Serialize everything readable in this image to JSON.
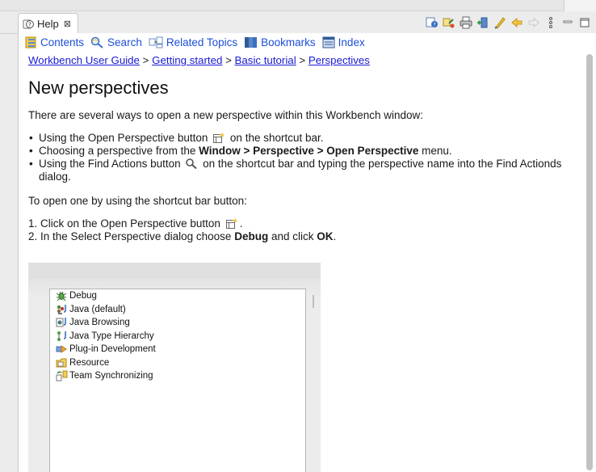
{
  "view_tab": {
    "title": "Help",
    "close_glyph": "⊠"
  },
  "toolbar": {
    "icons": [
      "show-in-toc-icon",
      "link-icon",
      "print-icon",
      "bookmark-add-icon",
      "highlight-icon",
      "back-icon",
      "forward-icon",
      "view-menu-icon",
      "minimize-icon",
      "maximize-icon"
    ]
  },
  "navbar": {
    "items": [
      {
        "label": "Contents",
        "icon": "contents-icon"
      },
      {
        "label": "Search",
        "icon": "search-icon"
      },
      {
        "label": "Related Topics",
        "icon": "related-topics-icon"
      },
      {
        "label": "Bookmarks",
        "icon": "bookmarks-icon"
      },
      {
        "label": "Index",
        "icon": "index-icon"
      }
    ]
  },
  "breadcrumb": {
    "links": [
      "Workbench User Guide",
      "Getting started",
      "Basic tutorial",
      "Perspectives"
    ],
    "separator": ">"
  },
  "article": {
    "title": "New perspectives",
    "intro": "There are several ways to open a new perspective within this Workbench window:",
    "bullet1_pre": "Using the Open Perspective button",
    "bullet1_post": "on the shortcut bar.",
    "bullet2_pre": "Choosing a perspective from the",
    "bullet2_bold": "Window > Perspective > Open Perspective",
    "bullet2_post": "menu.",
    "bullet3_pre": "Using the Find Actions button",
    "bullet3_post": "on the shortcut bar and typing the perspective name into the Find Actionds dialog.",
    "lead": "To open one by using the shortcut bar button:",
    "step1_num": "1.",
    "step1_pre": "Click on the Open Perspective button",
    "step1_post": ".",
    "step2_num": "2.",
    "step2_pre": "In the Select Perspective dialog choose",
    "step2_bold1": "Debug",
    "step2_mid": "and click",
    "step2_bold2": "OK",
    "step2_post": "."
  },
  "perspectives": [
    {
      "label": "Debug",
      "icon": "debug-icon"
    },
    {
      "label": "Java (default)",
      "icon": "java-icon"
    },
    {
      "label": "Java Browsing",
      "icon": "java-browsing-icon"
    },
    {
      "label": "Java Type Hierarchy",
      "icon": "type-hierarchy-icon"
    },
    {
      "label": "Plug-in Development",
      "icon": "plugin-icon"
    },
    {
      "label": "Resource",
      "icon": "resource-icon"
    },
    {
      "label": "Team Synchronizing",
      "icon": "team-sync-icon"
    }
  ],
  "colors": {
    "link": "#1a1ad4",
    "nav_link": "#1d4fd8",
    "background": "#ffffff",
    "chrome": "#ececec"
  }
}
